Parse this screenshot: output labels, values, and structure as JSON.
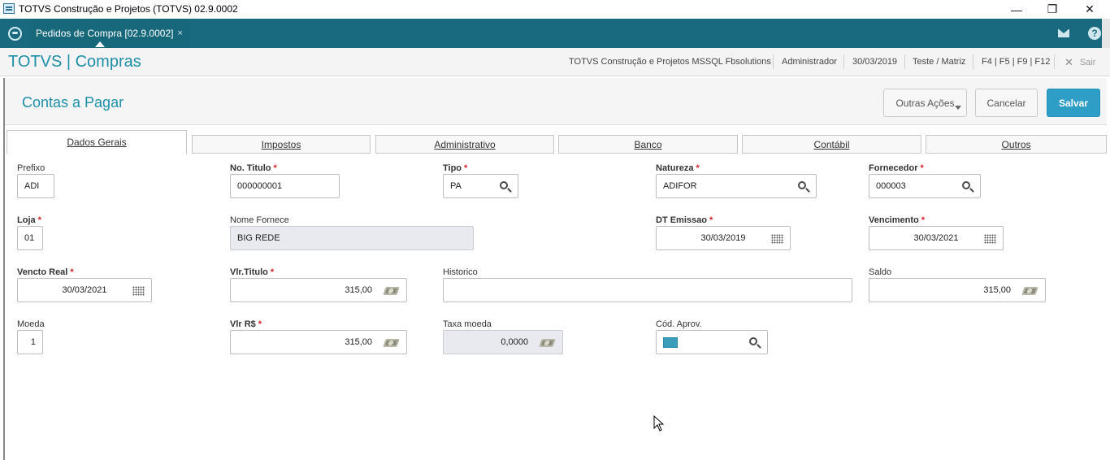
{
  "window": {
    "title": "TOTVS Construção e Projetos (TOTVS) 02.9.0002",
    "minimize": "—",
    "maximize": "❐",
    "close": "✕"
  },
  "tabbar": {
    "active_tab": "Pedidos de Compra [02.9.0002]",
    "tab_close": "×",
    "help": "?"
  },
  "header": {
    "app_title": "TOTVS | Compras",
    "environment": "TOTVS Construção e Projetos MSSQL Fbsolutions",
    "user": "Administrador",
    "date": "30/03/2019",
    "company": "Teste / Matriz",
    "shortcuts": "F4 | F5 | F9 | F12",
    "exit": "Sair"
  },
  "page": {
    "title": "Contas a Pagar",
    "buttons": {
      "more_actions": "Outras Ações",
      "cancel": "Cancelar",
      "save": "Salvar"
    }
  },
  "tabs": [
    "Dados Gerais",
    "Impostos",
    "Administrativo",
    "Banco",
    "Contábil",
    "Outros"
  ],
  "form": {
    "prefixo": {
      "label": "Prefixo",
      "value": "ADI"
    },
    "no_titulo": {
      "label": "No. Titulo",
      "value": "000000001"
    },
    "tipo": {
      "label": "Tipo",
      "value": "PA"
    },
    "natureza": {
      "label": "Natureza",
      "value": "ADIFOR"
    },
    "fornecedor": {
      "label": "Fornecedor",
      "value": "000003"
    },
    "loja": {
      "label": "Loja",
      "value": "01"
    },
    "nome_fornece": {
      "label": "Nome Fornece",
      "value": "BIG REDE"
    },
    "dt_emissao": {
      "label": "DT Emissao",
      "value": "30/03/2019"
    },
    "vencimento": {
      "label": "Vencimento",
      "value": "30/03/2021"
    },
    "vencto_real": {
      "label": "Vencto Real",
      "value": "30/03/2021"
    },
    "vlr_titulo": {
      "label": "Vlr.Titulo",
      "value": "315,00"
    },
    "historico": {
      "label": "Historico",
      "value": ""
    },
    "saldo": {
      "label": "Saldo",
      "value": "315,00"
    },
    "moeda": {
      "label": "Moeda",
      "value": "1"
    },
    "vlr_rs": {
      "label": "Vlr R$",
      "value": "315,00"
    },
    "taxa_moeda": {
      "label": "Taxa moeda",
      "value": "0,0000"
    },
    "cod_aprov": {
      "label": "Cód. Aprov.",
      "value": ""
    },
    "required_mark": "*"
  },
  "colors": {
    "tabbar": "#196a7e",
    "accent": "#1e8fa8",
    "primary_button": "#2e9ec7",
    "required": "#d61f26"
  }
}
